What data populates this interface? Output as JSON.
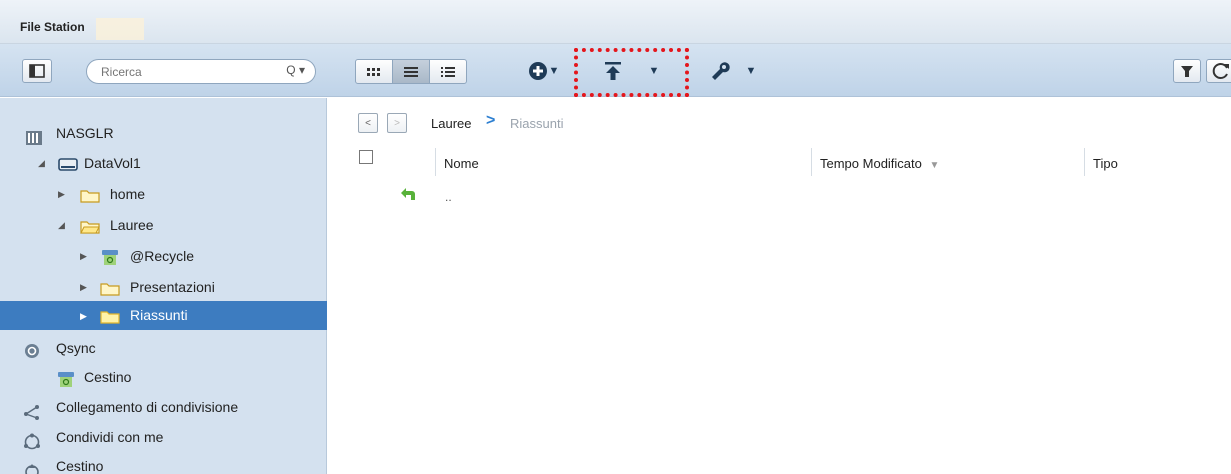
{
  "window": {
    "title": "File Station"
  },
  "toolbar": {
    "search_placeholder": "Ricerca",
    "search_icon": "Q ▾",
    "view_modes": [
      "thumbnails",
      "list",
      "details"
    ],
    "active_view": "list"
  },
  "sidebar": {
    "items": [
      {
        "label": "NASGLR",
        "icon": "nas-icon",
        "level": 0
      },
      {
        "label": "DataVol1",
        "icon": "volume-icon",
        "level": 1
      },
      {
        "label": "home",
        "icon": "folder-icon",
        "level": 2
      },
      {
        "label": "Lauree",
        "icon": "folder-open-icon",
        "level": 2
      },
      {
        "label": "@Recycle",
        "icon": "recycle-icon",
        "level": 3
      },
      {
        "label": "Presentazioni",
        "icon": "folder-icon",
        "level": 3
      },
      {
        "label": "Riassunti",
        "icon": "folder-icon",
        "level": 3,
        "selected": true
      },
      {
        "label": "Qsync",
        "icon": "qsync-icon",
        "level": 0
      },
      {
        "label": "Cestino",
        "icon": "recycle-icon",
        "level": 1
      },
      {
        "label": "Collegamento di condivisione",
        "icon": "share-link-icon",
        "level": 0
      },
      {
        "label": "Condividi con me",
        "icon": "shared-with-me-icon",
        "level": 0
      },
      {
        "label": "Cestino",
        "icon": "trash-icon",
        "level": 0
      }
    ]
  },
  "main": {
    "breadcrumb": {
      "parent": "Lauree",
      "separator": ">",
      "current": "Riassunti"
    },
    "columns": {
      "name": "Nome",
      "modified": "Tempo Modificato",
      "type": "Tipo"
    },
    "rows": [
      {
        "name": ".."
      }
    ]
  },
  "colors": {
    "accent": "#3d7cc0",
    "highlight": "#e4161c",
    "sidebar_bg": "#d4e1ef"
  }
}
